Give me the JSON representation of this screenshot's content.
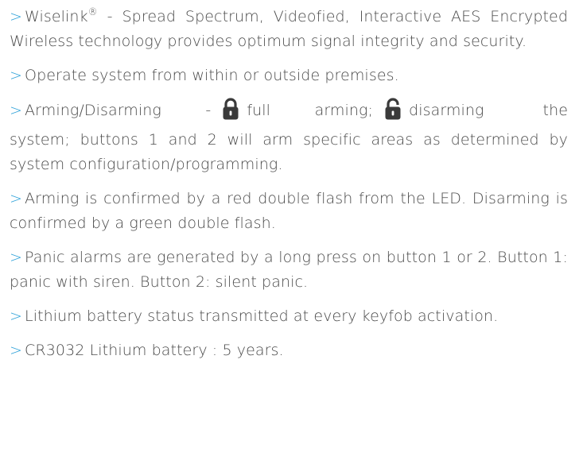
{
  "marker": ">",
  "items": [
    {
      "brand": "Wiselink",
      "reg": "®",
      "text": " - Spread Spectrum, Videofied, Interactive AES Encrypted Wireless technology provides optimum signal integrity and security."
    },
    {
      "text": "Operate system from within or outside premises."
    },
    {
      "lead": "Arming/Disarming -",
      "lock_closed_icon": "lock-closed-icon",
      "full_arming": "full arming;",
      "lock_open_icon": "lock-open-icon",
      "disarming": "disarming",
      "the": "the",
      "rest": "system; buttons 1 and 2 will arm specific areas as determined by system configuration/programming."
    },
    {
      "text": "Arming is confirmed by a red double flash from the LED. Disarming is confirmed by a green double flash."
    },
    {
      "text": "Panic alarms are generated by a long press on button 1 or 2. Button 1: panic with siren. Button 2: silent panic."
    },
    {
      "text": "Lithium battery status transmitted at every keyfob activation."
    },
    {
      "text": "CR3032 Lithium battery : 5 years."
    }
  ],
  "colors": {
    "marker": "#2ba0d8",
    "text": "#4a4a4a",
    "icon": "#3a3a3a"
  }
}
